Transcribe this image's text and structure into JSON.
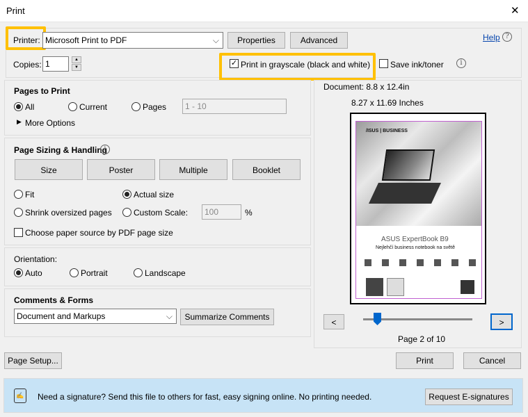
{
  "window": {
    "title": "Print",
    "close": "✕"
  },
  "printer": {
    "label": "Printer:",
    "value": "Microsoft Print to PDF",
    "properties": "Properties",
    "advanced": "Advanced",
    "help": "Help",
    "help_icon": "?"
  },
  "copies": {
    "label": "Copies:",
    "value": "1"
  },
  "grayscale": {
    "label": "Print in grayscale (black and white)",
    "checked": true
  },
  "save_ink": {
    "label": "Save ink/toner",
    "checked": false
  },
  "info_icon": "i",
  "pages_to_print": {
    "title": "Pages to Print",
    "all": "All",
    "current": "Current",
    "pages": "Pages",
    "range": "1 - 10",
    "more": "More Options",
    "selected": "All"
  },
  "sizing": {
    "title": "Page Sizing & Handling",
    "tabs": [
      "Size",
      "Poster",
      "Multiple",
      "Booklet"
    ],
    "fit": "Fit",
    "actual": "Actual size",
    "shrink": "Shrink oversized pages",
    "custom": "Custom Scale:",
    "scale": "100",
    "pct": "%",
    "paper_source": "Choose paper source by PDF page size",
    "selected": "Actual size"
  },
  "orientation": {
    "title": "Orientation:",
    "auto": "Auto",
    "portrait": "Portrait",
    "landscape": "Landscape",
    "selected": "Auto"
  },
  "comments": {
    "title": "Comments & Forms",
    "value": "Document and Markups",
    "summarize": "Summarize Comments"
  },
  "preview": {
    "document": "Document: 8.8 x 12.4in",
    "paper": "8.27 x 11.69 Inches",
    "prev": "<",
    "next": ">",
    "page": "Page 2 of 10",
    "current_page": 2,
    "total_pages": 10,
    "content": {
      "brand": "/ISUS | BUSINESS",
      "product": "ASUS ExpertBook B9",
      "tagline": "Nejlehčí business notebook na světě"
    }
  },
  "footer": {
    "page_setup": "Page Setup...",
    "print": "Print",
    "cancel": "Cancel"
  },
  "banner": {
    "text": "Need a signature? Send this file to others for fast, easy signing online. No printing needed.",
    "button": "Request E-signatures",
    "bg": "#c7e3f6"
  },
  "colors": {
    "highlight": "#ffc000",
    "accent": "#0066cc"
  }
}
